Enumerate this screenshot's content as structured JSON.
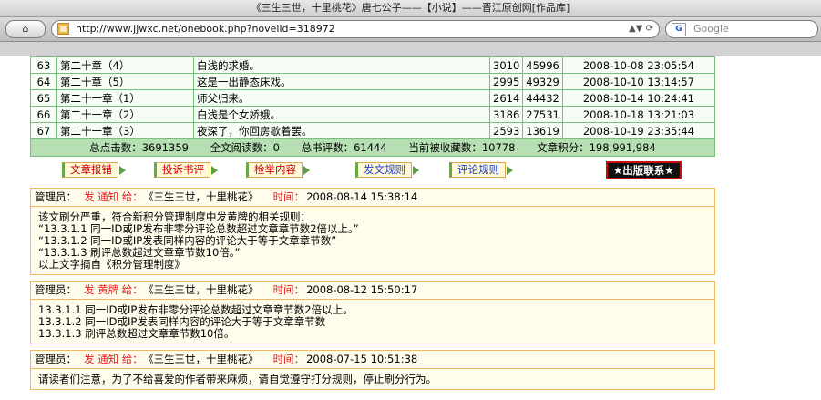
{
  "browser": {
    "title": "《三生三世，十里桃花》唐七公子——【小说】——晋江原创网[作品库]",
    "back_icon": "home-icon",
    "url": "http://www.jjwxc.net/onebook.php?novelid=318972",
    "search_placeholder": "Google"
  },
  "chapters": [
    {
      "index": "63",
      "title": "第二十章（4）",
      "summary": "白浅的求婚。",
      "words": "3010",
      "clicks": "45996",
      "time": "2008-10-08 23:05:54"
    },
    {
      "index": "64",
      "title": "第二十章（5）",
      "summary": "这是一出静态床戏。",
      "words": "2995",
      "clicks": "49329",
      "time": "2008-10-10 13:14:57"
    },
    {
      "index": "65",
      "title": "第二十一章（1）",
      "summary": "师父归来。",
      "words": "2614",
      "clicks": "44432",
      "time": "2008-10-14 10:24:41"
    },
    {
      "index": "66",
      "title": "第二十一章（2）",
      "summary": "白浅是个女娇娥。",
      "words": "3186",
      "clicks": "27531",
      "time": "2008-10-18 13:21:03"
    },
    {
      "index": "67",
      "title": "第二十一章（3）",
      "summary": "夜深了，你回房歇着罢。",
      "words": "2593",
      "clicks": "13619",
      "time": "2008-10-19 23:35:44"
    }
  ],
  "stats": {
    "total_clicks": "总点击数：3691359",
    "full_reads": "全文阅读数：0",
    "total_reviews": "总书评数：61444",
    "favorites": "当前被收藏数：10778",
    "points": "文章积分：198,991,984"
  },
  "actions": {
    "report_error": "文章报错",
    "complain": "投诉书评",
    "report_content": "检举内容",
    "publish_rules": "发文规则",
    "review_rules": "评论规则",
    "publishing_contact": "★出版联系★"
  },
  "notices": [
    {
      "admin": "管理员：",
      "action": "发 通知 给：",
      "work": "《三生三世，十里桃花》",
      "time_label": "时间：",
      "time": "2008-08-14 15:38:14",
      "lines": [
        "该文刷分严重，符合新积分管理制度中发黄牌的相关规则：",
        "“13.3.1.1 同一ID或IP发布非零分评论总数超过文章章节数2倍以上。”",
        "“13.3.1.2 同一ID或IP发表同样内容的评论大于等于文章章节数”",
        "“13.3.1.3 刷评总数超过文章章节数10倍。”",
        "以上文字摘自《积分管理制度》"
      ]
    },
    {
      "admin": "管理员：",
      "action": "发 黄牌 给：",
      "work": "《三生三世，十里桃花》",
      "time_label": "时间：",
      "time": "2008-08-12 15:50:17",
      "lines": [
        "13.3.1.1 同一ID或IP发布非零分评论总数超过文章章节数2倍以上。",
        "13.3.1.2 同一ID或IP发表同样内容的评论大于等于文章章节数",
        "13.3.1.3 刷评总数超过文章章节数10倍。"
      ]
    },
    {
      "admin": "管理员：",
      "action": "发 通知 给：",
      "work": "《三生三世，十里桃花》",
      "time_label": "时间：",
      "time": "2008-07-15 10:51:38",
      "lines": [
        "请读者们注意，为了不给喜爱的作者带来麻烦，请自觉遵守打分规则，停止刷分行为。"
      ]
    }
  ]
}
